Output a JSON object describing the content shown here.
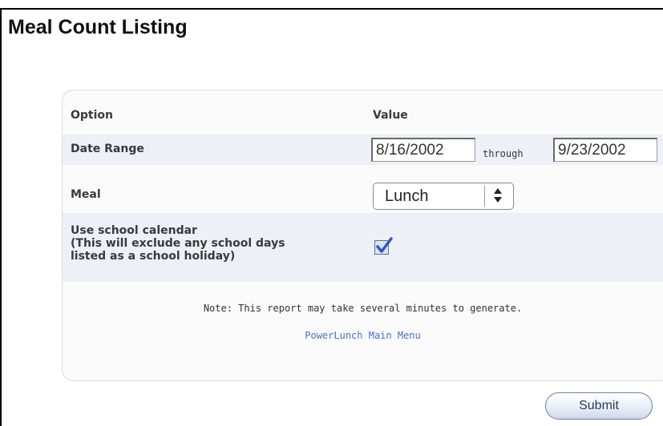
{
  "page": {
    "title": "Meal Count Listing"
  },
  "table": {
    "header": {
      "option": "Option",
      "value": "Value"
    },
    "date_range": {
      "label": "Date Range",
      "start": "8/16/2002",
      "through_label": "through",
      "end": "9/23/2002"
    },
    "meal": {
      "label": "Meal",
      "selected": "Lunch",
      "arrows_icon": "up-down-arrows"
    },
    "calendar": {
      "label_line1": "Use school calendar",
      "label_line2": "(This will exclude any school days",
      "label_line3": "listed as a school holiday)",
      "checked": true
    }
  },
  "note": "Note: This report may take several minutes to generate.",
  "menu_link": "PowerLunch Main Menu",
  "submit_label": "Submit",
  "colors": {
    "row_stripe": "#eef0f8",
    "link": "#4a6fd0",
    "check": "#2f55c8"
  }
}
